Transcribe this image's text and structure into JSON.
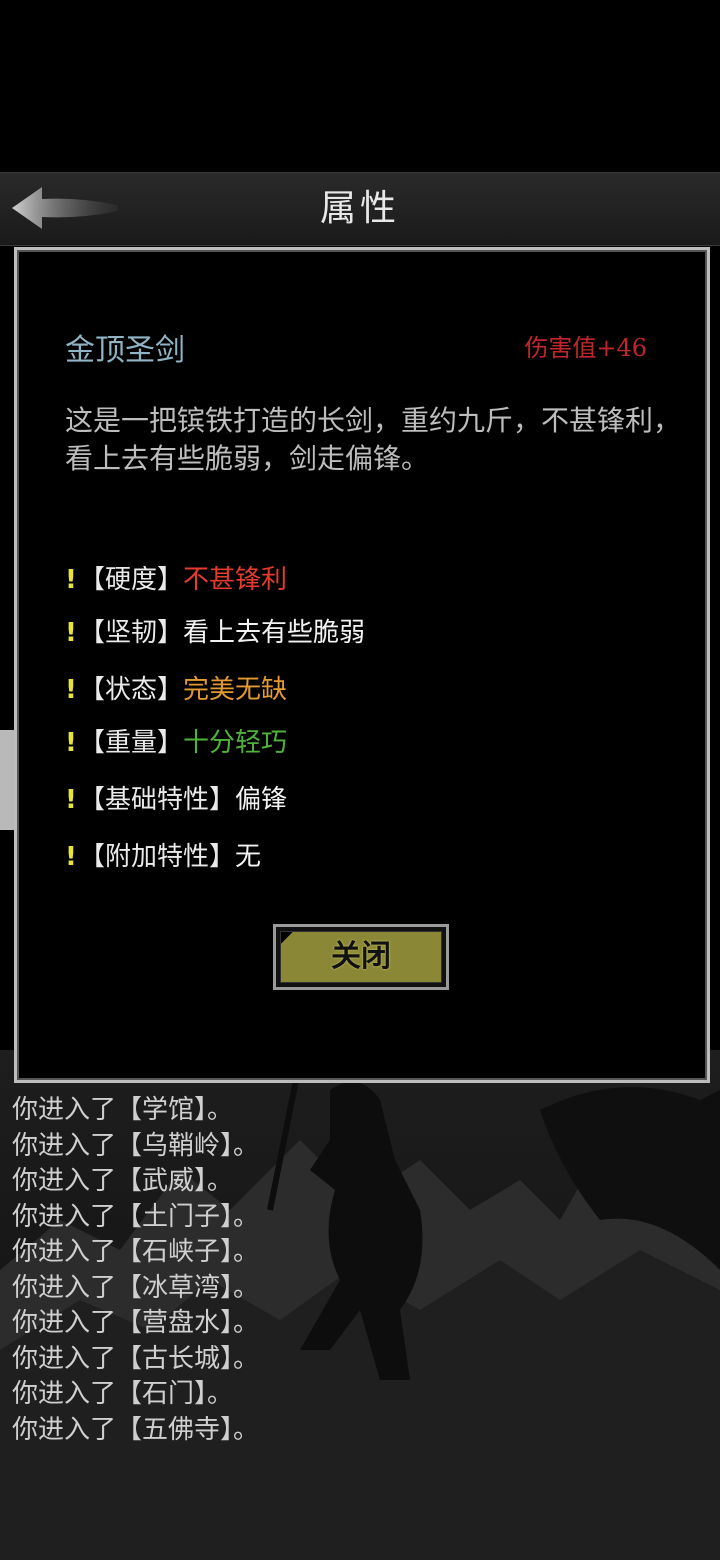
{
  "header": {
    "title": "属性"
  },
  "item": {
    "name": "金顶圣剑",
    "damage": "伤害值+46",
    "description": "这是一把镔铁打造的长剑，重约九斤，不甚锋利，看上去有些脆弱，剑走偏锋。"
  },
  "attributes": [
    {
      "mark": "!",
      "label": "【硬度】",
      "value": "不甚锋利",
      "color": "#e53b2e"
    },
    {
      "mark": "!",
      "label": "【坚韧】",
      "value": "看上去有些脆弱",
      "color": "#f2f2f2"
    },
    {
      "mark": "!",
      "label": "【状态】",
      "value": "完美无缺",
      "color": "#e39a31"
    },
    {
      "mark": "!",
      "label": "【重量】",
      "value": "十分轻巧",
      "color": "#4fb33a"
    },
    {
      "mark": "!",
      "label": "【基础特性】",
      "value": "偏锋",
      "color": "#f2f2f2"
    },
    {
      "mark": "!",
      "label": "【附加特性】",
      "value": "无",
      "color": "#f2f2f2"
    }
  ],
  "close_button": {
    "label": "关闭"
  },
  "log": [
    "你进入了【学馆】。",
    "你进入了【乌鞘岭】。",
    "你进入了【武威】。",
    "你进入了【土门子】。",
    "你进入了【石峡子】。",
    "你进入了【冰草湾】。",
    "你进入了【营盘水】。",
    "你进入了【古长城】。",
    "你进入了【石门】。",
    "你进入了【五佛寺】。"
  ],
  "icons": {
    "back": "back-arrow-icon",
    "attr_mark": "exclamation-icon"
  }
}
